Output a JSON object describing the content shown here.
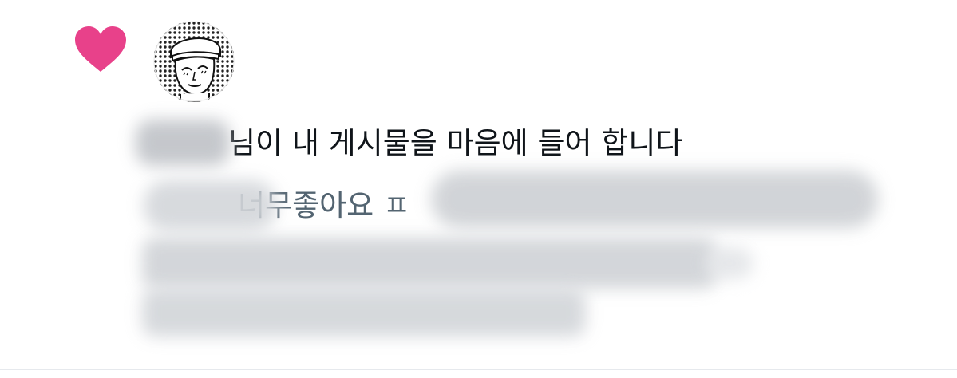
{
  "notification": {
    "type_icon": "heart-icon",
    "heart_color": "#e8418a",
    "avatar_icon": "cartoon-avatar-icon",
    "title_text": "님이 내 게시물을 마음에 들어 합니다",
    "preview_text": "너무좋아요",
    "preview_continuation": "ㅍ"
  }
}
